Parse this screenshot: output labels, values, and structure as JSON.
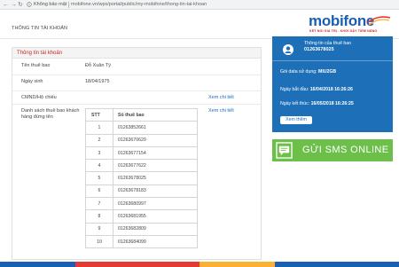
{
  "browser": {
    "secure_label": "Không bảo mật",
    "url": "mobifone.vn/wps/portal/public/my-mobifone/thong-tin-tai-khoan"
  },
  "header": {
    "page_title": "THÔNG TIN TÀI KHOẢN",
    "logo_text": "mobifone",
    "logo_tagline": "KẾT NỐI GIÁ TRỊ - KHƠI DẬY TIỀM NĂNG"
  },
  "account_panel": {
    "title": "Thông tin tài khoản",
    "subscriber_label": "Tên thuê bao",
    "subscriber_value": "Đỗ Xuân Tý",
    "dob_label": "Ngày sinh",
    "dob_value": "18/04/1975",
    "id_label": "CMND/Hộ chiếu",
    "id_link": "Xem chi tiết",
    "list_label": "Danh sách thuê bao khách hàng đứng tên",
    "list_link": "Xem chi tiết",
    "table": {
      "headers": [
        "STT",
        "Số thuê bao"
      ],
      "rows": [
        [
          "1",
          "01263852661"
        ],
        [
          "2",
          "01263670620"
        ],
        [
          "3",
          "01263677154"
        ],
        [
          "4",
          "01263677622"
        ],
        [
          "5",
          "01263678025"
        ],
        [
          "6",
          "01263678183"
        ],
        [
          "7",
          "01263680997"
        ],
        [
          "8",
          "01263681955"
        ],
        [
          "9",
          "01263682809"
        ],
        [
          "10",
          "01263684099"
        ]
      ]
    }
  },
  "subscriber_card": {
    "info_label": "Thông tin của thuê bao",
    "number": "01263678025",
    "plan_label": "Gói data sử dụng:",
    "plan_value": "MIU2GB",
    "start_label": "Ngày bắt đầu:",
    "start_value": "16/04/2018 16:26:26",
    "end_label": "Ngày kết thúc:",
    "end_value": "16/05/2018 16:26:25",
    "more_button": "Xem thêm"
  },
  "sms_button": {
    "label": "GỬI SMS ONLINE"
  },
  "colors": {
    "brand_blue": "#1a5fb4",
    "brand_red": "#c62828",
    "card_blue": "#1d6fb8",
    "sms_green": "#6cc04a",
    "footer_stripes": [
      "#1a5fb4",
      "#e53935",
      "#f9b233",
      "#1a5fb4"
    ]
  }
}
